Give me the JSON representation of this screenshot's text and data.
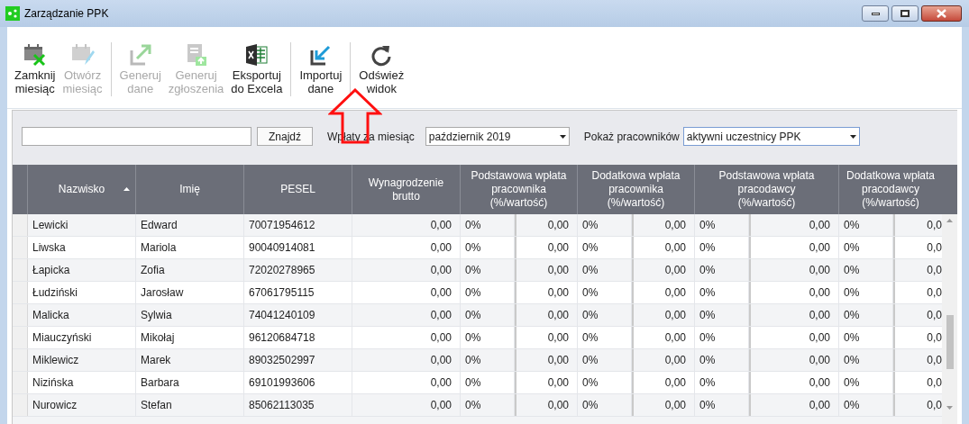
{
  "window": {
    "title": "Zarządzanie PPK"
  },
  "toolbar": {
    "groups": [
      [
        {
          "kind": "close-month",
          "label": [
            "Zamknij",
            "miesiąc"
          ],
          "disabled": false
        },
        {
          "kind": "open-month",
          "label": [
            "Otwórz",
            "miesiąc"
          ],
          "disabled": true
        }
      ],
      [
        {
          "kind": "export-arrow",
          "label": [
            "Generuj",
            "dane"
          ],
          "disabled": true
        },
        {
          "kind": "doc-upload",
          "label": [
            "Generuj",
            "zgłoszenia"
          ],
          "disabled": true
        },
        {
          "kind": "excel",
          "label": [
            "Eksportuj",
            "do Excela"
          ],
          "disabled": false
        }
      ],
      [
        {
          "kind": "import-arrow",
          "label": [
            "Importuj",
            "dane"
          ],
          "disabled": false
        }
      ],
      [
        {
          "kind": "refresh",
          "label": [
            "Odśwież",
            "widok"
          ],
          "disabled": false
        }
      ]
    ]
  },
  "filters": {
    "find_button": "Znajdź",
    "month": {
      "label": "Wpłaty za miesiąc",
      "value": "październik 2019",
      "focused": false
    },
    "employees": {
      "label": "Pokaż pracowników",
      "value": "aktywni uczestnicy PPK",
      "focused": true
    }
  },
  "table": {
    "columns": [
      {
        "label": "Nazwisko",
        "sorted": true
      },
      {
        "label": "Imię",
        "sorted": false
      },
      {
        "label": "PESEL",
        "sorted": false
      },
      {
        "label": "Wynagrodzenie brutto",
        "sorted": false
      },
      {
        "label": "Podstawowa wpłata pracownika (%/wartość)",
        "sorted": false
      },
      {
        "label": "Dodatkowa wpłata pracownika (%/wartość)",
        "sorted": false
      },
      {
        "label": "Podstawowa wpłata pracodawcy (%/wartość)",
        "sorted": false
      },
      {
        "label": "Dodatkowa wpłata pracodawcy (%/wartość)",
        "sorted": false
      }
    ],
    "rows": [
      {
        "cells": [
          "Lewicki",
          "Edward",
          "70071954612",
          "0,00",
          {
            "percent": "0%",
            "amount": "0,00"
          },
          {
            "percent": "0%",
            "amount": "0,00"
          },
          {
            "percent": "0%",
            "amount": "0,00"
          },
          {
            "percent": "0%",
            "amount": "0,0"
          }
        ]
      },
      {
        "cells": [
          "Liwska",
          "Mariola",
          "90040914081",
          "0,00",
          {
            "percent": "0%",
            "amount": "0,00"
          },
          {
            "percent": "0%",
            "amount": "0,00"
          },
          {
            "percent": "0%",
            "amount": "0,00"
          },
          {
            "percent": "0%",
            "amount": "0,0"
          }
        ]
      },
      {
        "cells": [
          "Łapicka",
          "Zofia",
          "72020278965",
          "0,00",
          {
            "percent": "0%",
            "amount": "0,00"
          },
          {
            "percent": "0%",
            "amount": "0,00"
          },
          {
            "percent": "0%",
            "amount": "0,00"
          },
          {
            "percent": "0%",
            "amount": "0,0"
          }
        ]
      },
      {
        "cells": [
          "Łudziński",
          "Jarosław",
          "67061795115",
          "0,00",
          {
            "percent": "0%",
            "amount": "0,00"
          },
          {
            "percent": "0%",
            "amount": "0,00"
          },
          {
            "percent": "0%",
            "amount": "0,00"
          },
          {
            "percent": "0%",
            "amount": "0,0"
          }
        ]
      },
      {
        "cells": [
          "Malicka",
          "Sylwia",
          "74041240109",
          "0,00",
          {
            "percent": "0%",
            "amount": "0,00"
          },
          {
            "percent": "0%",
            "amount": "0,00"
          },
          {
            "percent": "0%",
            "amount": "0,00"
          },
          {
            "percent": "0%",
            "amount": "0,0"
          }
        ]
      },
      {
        "cells": [
          "Miauczyński",
          "Mikołaj",
          "96120684718",
          "0,00",
          {
            "percent": "0%",
            "amount": "0,00"
          },
          {
            "percent": "0%",
            "amount": "0,00"
          },
          {
            "percent": "0%",
            "amount": "0,00"
          },
          {
            "percent": "0%",
            "amount": "0,0"
          }
        ]
      },
      {
        "cells": [
          "Miklewicz",
          "Marek",
          "89032502997",
          "0,00",
          {
            "percent": "0%",
            "amount": "0,00"
          },
          {
            "percent": "0%",
            "amount": "0,00"
          },
          {
            "percent": "0%",
            "amount": "0,00"
          },
          {
            "percent": "0%",
            "amount": "0,0"
          }
        ]
      },
      {
        "cells": [
          "Nizińska",
          "Barbara",
          "69101993606",
          "0,00",
          {
            "percent": "0%",
            "amount": "0,00"
          },
          {
            "percent": "0%",
            "amount": "0,00"
          },
          {
            "percent": "0%",
            "amount": "0,00"
          },
          {
            "percent": "0%",
            "amount": "0,0"
          }
        ]
      },
      {
        "cells": [
          "Nurowicz",
          "Stefan",
          "85062113035",
          "0,00",
          {
            "percent": "0%",
            "amount": "0,00"
          },
          {
            "percent": "0%",
            "amount": "0,00"
          },
          {
            "percent": "0%",
            "amount": "0,00"
          },
          {
            "percent": "0%",
            "amount": "0,0"
          }
        ]
      }
    ]
  }
}
